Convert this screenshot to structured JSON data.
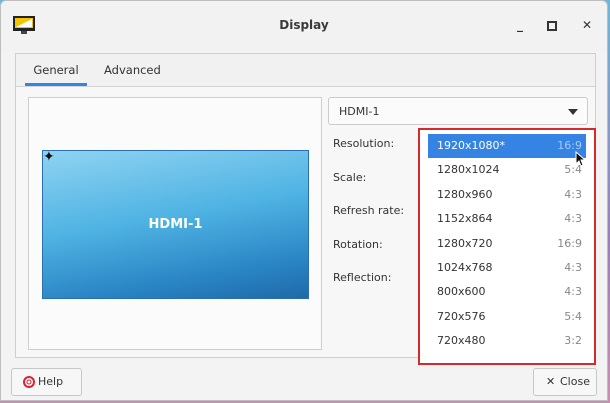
{
  "window": {
    "title": "Display"
  },
  "tabs": [
    {
      "label": "General",
      "active": true
    },
    {
      "label": "Advanced",
      "active": false
    }
  ],
  "preview": {
    "monitor_label": "HDMI-1",
    "primary_marker": "✦"
  },
  "output_select": {
    "value": "HDMI-1"
  },
  "fields": {
    "resolution_label": "Resolution:",
    "scale_label": "Scale:",
    "refresh_label": "Refresh rate:",
    "rotation_label": "Rotation:",
    "reflection_label": "Reflection:"
  },
  "resolution_options": [
    {
      "res": "1920x1080*",
      "ratio": "16:9",
      "selected": true
    },
    {
      "res": "1280x1024",
      "ratio": "5:4"
    },
    {
      "res": "1280x960",
      "ratio": "4:3"
    },
    {
      "res": "1152x864",
      "ratio": "4:3"
    },
    {
      "res": "1280x720",
      "ratio": "16:9"
    },
    {
      "res": "1024x768",
      "ratio": "4:3"
    },
    {
      "res": "800x600",
      "ratio": "4:3"
    },
    {
      "res": "720x576",
      "ratio": "5:4"
    },
    {
      "res": "720x480",
      "ratio": "3:2"
    }
  ],
  "buttons": {
    "help_label": "Help",
    "close_label": "Close",
    "close_icon": "✕"
  },
  "colors": {
    "accent": "#3584e4",
    "highlight_border": "#d12b2b"
  }
}
